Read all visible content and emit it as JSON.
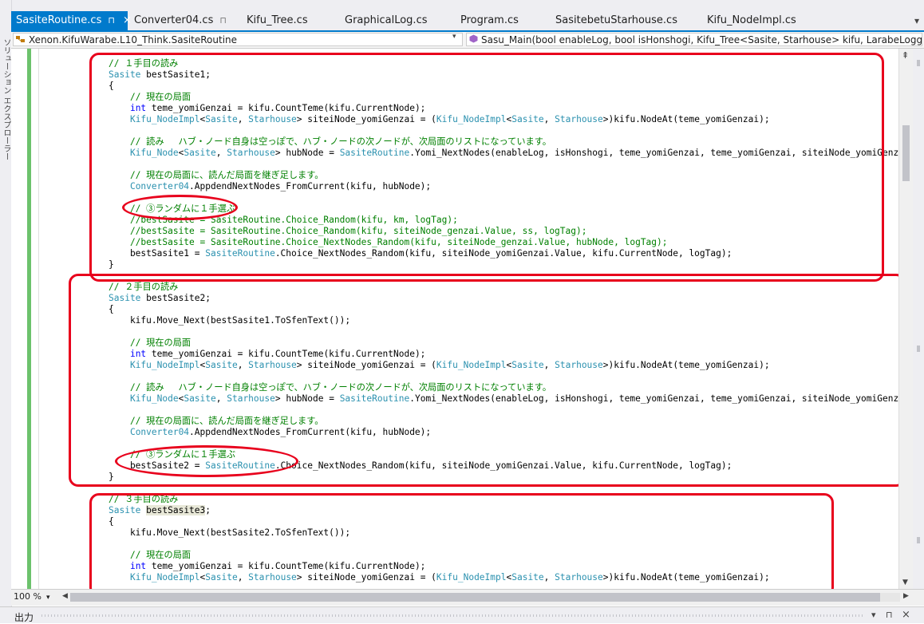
{
  "left_strip": {
    "text": "ソリューション エクスプローラー"
  },
  "tabs": [
    {
      "label": "SasiteRoutine.cs",
      "active": true,
      "pin": "⊓",
      "close": "×"
    },
    {
      "label": "Converter04.cs",
      "active": false,
      "pin": "⊓"
    },
    {
      "label": "Kifu_Tree.cs",
      "active": false
    },
    {
      "label": "GraphicalLog.cs",
      "active": false
    },
    {
      "label": "Program.cs",
      "active": false
    },
    {
      "label": "SasitebetuStarhouse.cs",
      "active": false
    },
    {
      "label": "Kifu_NodeImpl.cs",
      "active": false
    }
  ],
  "tab_overflow": "▾",
  "nav": {
    "class_scope": "Xenon.KifuWarabe.L10_Think.SasiteRoutine",
    "member_scope": "Sasu_Main(bool enableLog, bool isHonshogi, Kifu_Tree<Sasite, Starhouse> kifu, LarabeLoggerTag logTag)",
    "class_icon": "class-icon",
    "method_icon": "method-icon"
  },
  "code_lines": [
    [
      [
        "cm",
        "// １手目の読み"
      ]
    ],
    [
      [
        "ty",
        "Sasite"
      ],
      [
        "",
        "bestSasite1;"
      ]
    ],
    [
      [
        "",
        "{"
      ]
    ],
    [
      [
        "",
        "    "
      ],
      [
        "cm",
        "// 現在の局面"
      ]
    ],
    [
      [
        "",
        "    "
      ],
      [
        "kw",
        "int"
      ],
      [
        "",
        " teme_yomiGenzai = kifu.CountTeme(kifu.CurrentNode);"
      ]
    ],
    [
      [
        "",
        "    "
      ],
      [
        "ty",
        "Kifu_NodeImpl"
      ],
      [
        "",
        "<"
      ],
      [
        "ty",
        "Sasite"
      ],
      [
        "",
        ", "
      ],
      [
        "ty",
        "Starhouse"
      ],
      [
        "",
        "> siteiNode_yomiGenzai = ("
      ],
      [
        "ty",
        "Kifu_NodeImpl"
      ],
      [
        "",
        "<"
      ],
      [
        "ty",
        "Sasite"
      ],
      [
        "",
        ", "
      ],
      [
        "ty",
        "Starhouse"
      ],
      [
        "",
        ">)kifu.NodeAt(teme_yomiGenzai);"
      ]
    ],
    [
      [
        "",
        ""
      ]
    ],
    [
      [
        "",
        "    "
      ],
      [
        "cm",
        "// 読み　 ハブ・ノード自身は空っぽで、ハブ・ノードの次ノードが、次局面のリストになっています。"
      ]
    ],
    [
      [
        "",
        "    "
      ],
      [
        "ty",
        "Kifu_Node"
      ],
      [
        "",
        "<"
      ],
      [
        "ty",
        "Sasite"
      ],
      [
        "",
        ", "
      ],
      [
        "ty",
        "Starhouse"
      ],
      [
        "",
        "> hubNode = "
      ],
      [
        "ty",
        "SasiteRoutine"
      ],
      [
        "",
        ".Yomi_NextNodes(enableLog, isHonshogi, teme_yomiGenzai, teme_yomiGenzai, siteiNode_yomiGenzai.Value);"
      ]
    ],
    [
      [
        "",
        ""
      ]
    ],
    [
      [
        "",
        "    "
      ],
      [
        "cm",
        "// 現在の局面に、読んだ局面を継ぎ足します。"
      ]
    ],
    [
      [
        "",
        "    "
      ],
      [
        "ty",
        "Converter04"
      ],
      [
        "",
        ".AppdendNextNodes_FromCurrent(kifu, hubNode);"
      ]
    ],
    [
      [
        "",
        ""
      ]
    ],
    [
      [
        "",
        "    "
      ],
      [
        "cm",
        "// ③ランダムに１手選ぶ"
      ]
    ],
    [
      [
        "",
        "    "
      ],
      [
        "cm",
        "//bestSasite = SasiteRoutine.Choice_Random(kifu, km, logTag);"
      ]
    ],
    [
      [
        "",
        "    "
      ],
      [
        "cm",
        "//bestSasite = SasiteRoutine.Choice_Random(kifu, siteiNode_genzai.Value, ss, logTag);"
      ]
    ],
    [
      [
        "",
        "    "
      ],
      [
        "cm",
        "//bestSasite = SasiteRoutine.Choice_NextNodes_Random(kifu, siteiNode_genzai.Value, hubNode, logTag);"
      ]
    ],
    [
      [
        "",
        "    bestSasite1 = "
      ],
      [
        "ty",
        "SasiteRoutine"
      ],
      [
        "",
        ".Choice_NextNodes_Random(kifu, siteiNode_yomiGenzai.Value, kifu.CurrentNode, logTag);"
      ]
    ],
    [
      [
        "",
        "}"
      ]
    ],
    [
      [
        "",
        ""
      ]
    ],
    [
      [
        "cm",
        "// ２手目の読み"
      ]
    ],
    [
      [
        "ty",
        "Sasite"
      ],
      [
        "",
        "bestSasite2;"
      ]
    ],
    [
      [
        "",
        "{"
      ]
    ],
    [
      [
        "",
        "    kifu.Move_Next(bestSasite1.ToSfenText());"
      ]
    ],
    [
      [
        "",
        ""
      ]
    ],
    [
      [
        "",
        "    "
      ],
      [
        "cm",
        "// 現在の局面"
      ]
    ],
    [
      [
        "",
        "    "
      ],
      [
        "kw",
        "int"
      ],
      [
        "",
        " teme_yomiGenzai = kifu.CountTeme(kifu.CurrentNode);"
      ]
    ],
    [
      [
        "",
        "    "
      ],
      [
        "ty",
        "Kifu_NodeImpl"
      ],
      [
        "",
        "<"
      ],
      [
        "ty",
        "Sasite"
      ],
      [
        "",
        ", "
      ],
      [
        "ty",
        "Starhouse"
      ],
      [
        "",
        "> siteiNode_yomiGenzai = ("
      ],
      [
        "ty",
        "Kifu_NodeImpl"
      ],
      [
        "",
        "<"
      ],
      [
        "ty",
        "Sasite"
      ],
      [
        "",
        ", "
      ],
      [
        "ty",
        "Starhouse"
      ],
      [
        "",
        ">)kifu.NodeAt(teme_yomiGenzai);"
      ]
    ],
    [
      [
        "",
        ""
      ]
    ],
    [
      [
        "",
        "    "
      ],
      [
        "cm",
        "// 読み　 ハブ・ノード自身は空っぽで、ハブ・ノードの次ノードが、次局面のリストになっています。"
      ]
    ],
    [
      [
        "",
        "    "
      ],
      [
        "ty",
        "Kifu_Node"
      ],
      [
        "",
        "<"
      ],
      [
        "ty",
        "Sasite"
      ],
      [
        "",
        ", "
      ],
      [
        "ty",
        "Starhouse"
      ],
      [
        "",
        "> hubNode = "
      ],
      [
        "ty",
        "SasiteRoutine"
      ],
      [
        "",
        ".Yomi_NextNodes(enableLog, isHonshogi, teme_yomiGenzai, teme_yomiGenzai, siteiNode_yomiGenzai.Value);"
      ]
    ],
    [
      [
        "",
        ""
      ]
    ],
    [
      [
        "",
        "    "
      ],
      [
        "cm",
        "// 現在の局面に、読んだ局面を継ぎ足します。"
      ]
    ],
    [
      [
        "",
        "    "
      ],
      [
        "ty",
        "Converter04"
      ],
      [
        "",
        ".AppdendNextNodes_FromCurrent(kifu, hubNode);"
      ]
    ],
    [
      [
        "",
        ""
      ]
    ],
    [
      [
        "",
        "    "
      ],
      [
        "cm",
        "// ③ランダムに１手選ぶ"
      ]
    ],
    [
      [
        "",
        "    bestSasite2 = "
      ],
      [
        "ty",
        "SasiteRoutine"
      ],
      [
        "",
        ".Choice_NextNodes_Random(kifu, siteiNode_yomiGenzai.Value, kifu.CurrentNode, logTag);"
      ]
    ],
    [
      [
        "",
        "}"
      ]
    ],
    [
      [
        "",
        ""
      ]
    ],
    [
      [
        "cm",
        "// ３手目の読み"
      ]
    ],
    [
      [
        "ty",
        "Sasite"
      ],
      [
        "",
        ""
      ],
      [
        "hl",
        "bestSasite3"
      ],
      [
        "",
        ";"
      ]
    ],
    [
      [
        "",
        "{"
      ]
    ],
    [
      [
        "",
        "    kifu.Move_Next(bestSasite2.ToSfenText());"
      ]
    ],
    [
      [
        "",
        ""
      ]
    ],
    [
      [
        "",
        "    "
      ],
      [
        "cm",
        "// 現在の局面"
      ]
    ],
    [
      [
        "",
        "    "
      ],
      [
        "kw",
        "int"
      ],
      [
        "",
        " teme_yomiGenzai = kifu.CountTeme(kifu.CurrentNode);"
      ]
    ],
    [
      [
        "",
        "    "
      ],
      [
        "ty",
        "Kifu_NodeImpl"
      ],
      [
        "",
        "<"
      ],
      [
        "ty",
        "Sasite"
      ],
      [
        "",
        ", "
      ],
      [
        "ty",
        "Starhouse"
      ],
      [
        "",
        "> siteiNode_yomiGenzai = ("
      ],
      [
        "ty",
        "Kifu_NodeImpl"
      ],
      [
        "",
        "<"
      ],
      [
        "ty",
        "Sasite"
      ],
      [
        "",
        ", "
      ],
      [
        "ty",
        "Starhouse"
      ],
      [
        "",
        ">)kifu.NodeAt(teme_yomiGenzai);"
      ]
    ]
  ],
  "colors": {
    "comment": "#008000",
    "keyword": "#0000ff",
    "type": "#2b91af",
    "accent": "#007acc",
    "annotation": "#e8001c",
    "changed_marker": "#6cc26c"
  },
  "status": {
    "zoom": "100 %"
  },
  "output_panel": {
    "title": "出力",
    "pin": "⊓",
    "close": "×",
    "dropdown": "▾"
  }
}
